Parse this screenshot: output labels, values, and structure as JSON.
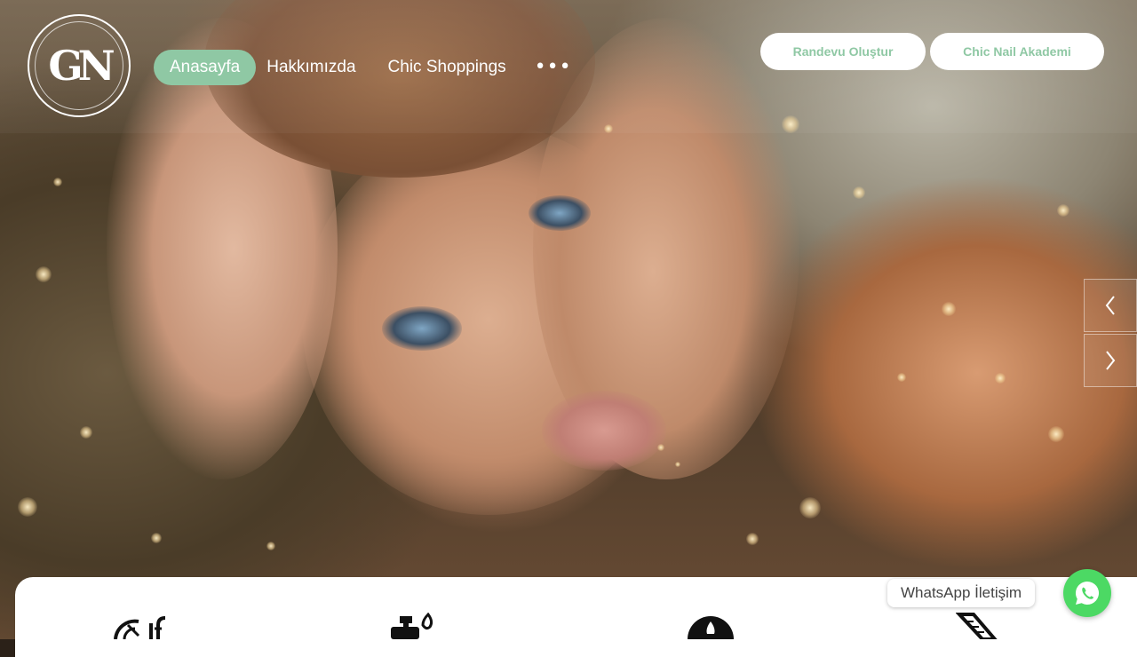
{
  "brand": {
    "logo_text": "GN"
  },
  "nav": {
    "items": [
      {
        "label": "Anasayfa",
        "active": true
      },
      {
        "label": "Hakkımızda",
        "active": false
      },
      {
        "label": "Chic Shoppings",
        "active": false
      }
    ],
    "more_icon": "more-horizontal-icon"
  },
  "header_buttons": {
    "appointment": "Randevu Oluştur",
    "academy": "Chic Nail Akademi"
  },
  "slider": {
    "prev_icon": "chevron-left-icon",
    "next_icon": "chevron-right-icon"
  },
  "features": {
    "icons": [
      "nail-polish-icon",
      "spray-bottle-icon",
      "drop-icon",
      "nail-file-icon"
    ]
  },
  "whatsapp": {
    "label": "WhatsApp İletişim",
    "icon": "whatsapp-icon"
  },
  "colors": {
    "accent": "#8fc8a4",
    "whatsapp_green": "#4cd964",
    "white": "#ffffff"
  }
}
